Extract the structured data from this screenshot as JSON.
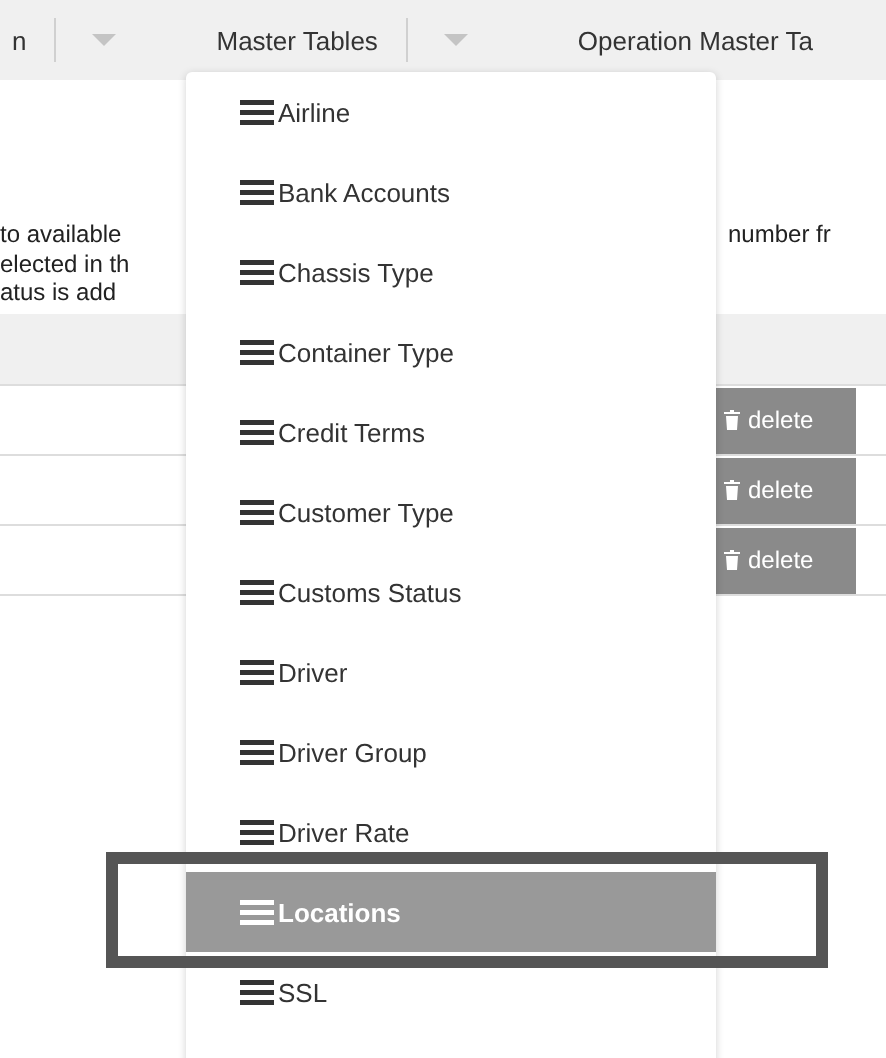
{
  "nav": {
    "items": [
      {
        "label": "n"
      },
      {
        "label": "Master Tables"
      },
      {
        "label": "Operation Master Ta"
      }
    ]
  },
  "description": {
    "left_lines": [
      "to available",
      "elected in th",
      "atus is add"
    ],
    "right_lines": [
      "number fr"
    ]
  },
  "table": {
    "rows": [
      {
        "action": "delete"
      },
      {
        "action": "delete"
      },
      {
        "action": "delete"
      }
    ]
  },
  "menu": {
    "items": [
      {
        "label": "Airline",
        "selected": false
      },
      {
        "label": "Bank Accounts",
        "selected": false
      },
      {
        "label": "Chassis Type",
        "selected": false
      },
      {
        "label": "Container Type",
        "selected": false
      },
      {
        "label": "Credit Terms",
        "selected": false
      },
      {
        "label": "Customer Type",
        "selected": false
      },
      {
        "label": "Customs Status",
        "selected": false
      },
      {
        "label": "Driver",
        "selected": false
      },
      {
        "label": "Driver Group",
        "selected": false
      },
      {
        "label": "Driver Rate",
        "selected": false
      },
      {
        "label": "Locations",
        "selected": true
      },
      {
        "label": "SSL",
        "selected": false
      }
    ]
  }
}
